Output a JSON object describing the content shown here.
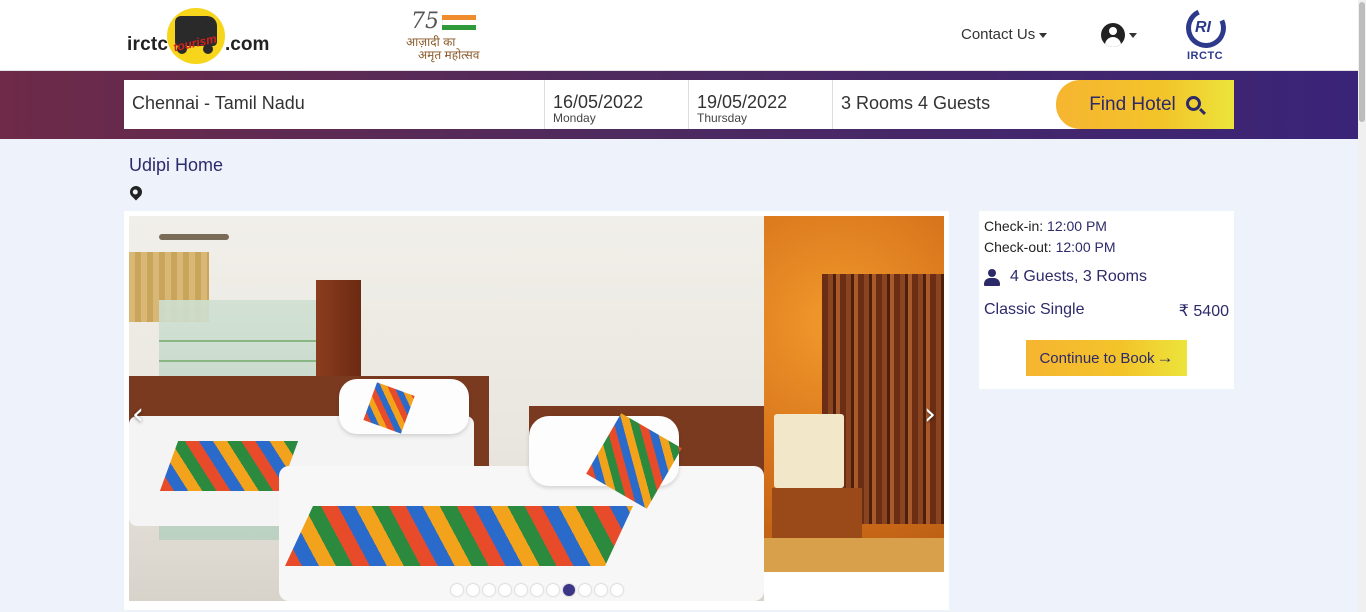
{
  "header": {
    "logo_left": "irctc",
    "logo_brand": "tourism",
    "logo_right": ".com",
    "azadi_num": "75",
    "azadi_line1": "आज़ादी का",
    "azadi_line2": "अमृत महोत्सव",
    "contact_label": "Contact Us",
    "irctc_logo_text": "IRCTC",
    "irctc_mark": "RI"
  },
  "search": {
    "city": "Chennai - Tamil Nadu",
    "checkin_date": "16/05/2022",
    "checkin_day": "Monday",
    "checkout_date": "19/05/2022",
    "checkout_day": "Thursday",
    "rooms_guests": "3 Rooms 4 Guests",
    "find_label": "Find Hotel"
  },
  "hotel": {
    "name": "Udipi Home",
    "carousel": {
      "prev": "‹",
      "next": "›",
      "dots": 11,
      "active_dot": 7
    }
  },
  "booking": {
    "checkin_label": "Check-in:",
    "checkin_time": "12:00 PM",
    "checkout_label": "Check-out:",
    "checkout_time": "12:00 PM",
    "guests_rooms": "4 Guests, 3 Rooms",
    "room_type": "Classic Single",
    "price": "₹ 5400",
    "continue_label": "Continue to Book",
    "continue_arrow": "→"
  },
  "colors": {
    "brand_navy": "#2d2a6a",
    "accent_yellow": "#f6b531",
    "band_start": "#6e2a48",
    "band_end": "#3a2478",
    "background": "#eef3fb"
  }
}
